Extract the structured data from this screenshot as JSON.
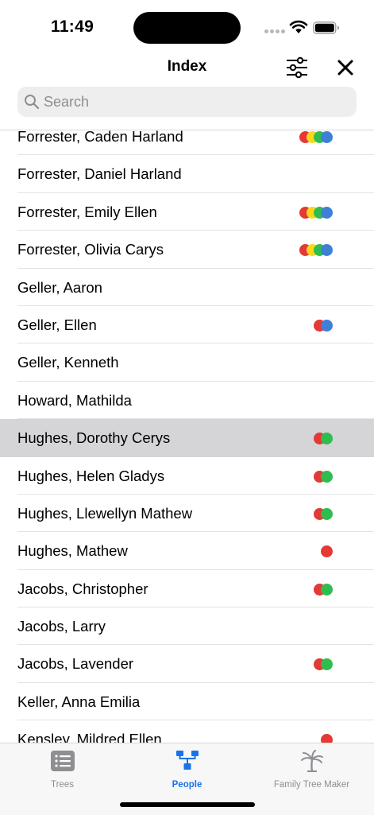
{
  "status_bar": {
    "time": "11:49"
  },
  "header": {
    "title": "Index"
  },
  "search": {
    "placeholder": "Search"
  },
  "colors": {
    "red": "#e53935",
    "yellow": "#f9d71c",
    "green": "#2ebd4e",
    "blue": "#3f7fd6",
    "accent": "#1a73e8",
    "selected_row": "#d5d5d8"
  },
  "people": [
    {
      "name": "Forrester, Caden Harland",
      "dots": [
        "red",
        "yellow",
        "green",
        "blue"
      ]
    },
    {
      "name": "Forrester, Daniel Harland",
      "dots": []
    },
    {
      "name": "Forrester, Emily Ellen",
      "dots": [
        "red",
        "yellow",
        "green",
        "blue"
      ]
    },
    {
      "name": "Forrester, Olivia Carys",
      "dots": [
        "red",
        "yellow",
        "green",
        "blue"
      ]
    },
    {
      "name": "Geller, Aaron",
      "dots": []
    },
    {
      "name": "Geller, Ellen",
      "dots": [
        "red",
        "blue"
      ]
    },
    {
      "name": "Geller, Kenneth",
      "dots": []
    },
    {
      "name": "Howard, Mathilda",
      "dots": []
    },
    {
      "name": "Hughes, Dorothy Cerys",
      "dots": [
        "red",
        "green"
      ],
      "selected": true
    },
    {
      "name": "Hughes, Helen Gladys",
      "dots": [
        "red",
        "green"
      ]
    },
    {
      "name": "Hughes, Llewellyn Mathew",
      "dots": [
        "red",
        "green"
      ]
    },
    {
      "name": "Hughes, Mathew",
      "dots": [
        "red"
      ]
    },
    {
      "name": "Jacobs, Christopher",
      "dots": [
        "red",
        "green"
      ]
    },
    {
      "name": "Jacobs, Larry",
      "dots": []
    },
    {
      "name": "Jacobs, Lavender",
      "dots": [
        "red",
        "green"
      ]
    },
    {
      "name": "Keller, Anna Emilia",
      "dots": []
    },
    {
      "name": "Kensley, Mildred Ellen",
      "dots": [
        "red"
      ]
    }
  ],
  "tabs": [
    {
      "label": "Trees",
      "icon": "list-icon",
      "active": false
    },
    {
      "label": "People",
      "icon": "people-tree-icon",
      "active": true
    },
    {
      "label": "Family Tree Maker",
      "icon": "tree-logo-icon",
      "active": false
    }
  ]
}
